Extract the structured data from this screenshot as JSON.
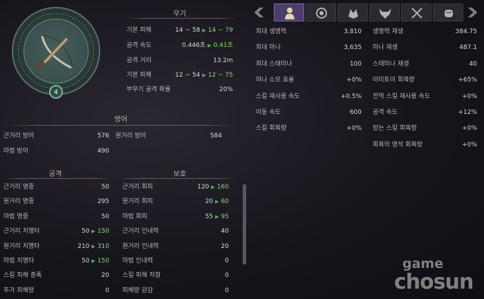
{
  "emblem": {
    "level": "4"
  },
  "weapon": {
    "title": "무기",
    "rows": [
      {
        "label": "기본 피해",
        "base": "14 ~ 58",
        "new": "14 ~ 79"
      },
      {
        "label": "공격 속도",
        "base": "0.446초",
        "new": "0.41초"
      },
      {
        "label": "공격 거리",
        "value": "13.2m"
      },
      {
        "label": "기본 피해",
        "base": "12 ~ 54",
        "new": "12 ~ 75"
      },
      {
        "label": "부무기 공격 확률",
        "value": "20%"
      }
    ]
  },
  "defense": {
    "title": "방어",
    "rows": [
      {
        "label": "근거리 방어",
        "value": "576"
      },
      {
        "label": "원거리 방어",
        "value": "584"
      },
      {
        "label": "마법 방어",
        "value": "490"
      }
    ]
  },
  "attack": {
    "title": "공격",
    "rows": [
      {
        "label": "근거리 명중",
        "value": "50"
      },
      {
        "label": "원거리 명중",
        "value": "295"
      },
      {
        "label": "마법 명중",
        "value": "50"
      },
      {
        "label": "근거리 치명타",
        "base": "50",
        "new": "150"
      },
      {
        "label": "원거리 치명타",
        "base": "210",
        "new": "310"
      },
      {
        "label": "마법 치명타",
        "base": "50",
        "new": "150"
      },
      {
        "label": "스킬 피해 증폭",
        "value": "20"
      },
      {
        "label": "추가 피해량",
        "value": "0"
      }
    ]
  },
  "protect": {
    "title": "보호",
    "rows": [
      {
        "label": "근거리 회피",
        "base": "120",
        "new": "160"
      },
      {
        "label": "원거리 회피",
        "base": "20",
        "new": "60"
      },
      {
        "label": "마법 회피",
        "base": "55",
        "new": "95"
      },
      {
        "label": "근거리 인내력",
        "value": "40"
      },
      {
        "label": "원거리 인내력",
        "value": "20"
      },
      {
        "label": "마법 인내력",
        "value": "0"
      },
      {
        "label": "스킬 피해 저항",
        "value": "0"
      },
      {
        "label": "피해량 감감",
        "value": "0"
      }
    ]
  },
  "tabs": [
    {
      "icon": "chevron-left-icon"
    },
    {
      "icon": "character-icon",
      "active": true
    },
    {
      "icon": "shield-icon"
    },
    {
      "icon": "wolf-icon"
    },
    {
      "icon": "demon-icon"
    },
    {
      "icon": "crossed-swords-icon"
    },
    {
      "icon": "fist-icon"
    },
    {
      "icon": "chevron-right-icon"
    }
  ],
  "stats_left": [
    {
      "label": "최대 생명력",
      "value": "3,810"
    },
    {
      "label": "최대 마나",
      "value": "3,635"
    },
    {
      "label": "최대 스태미나",
      "value": "100"
    },
    {
      "label": "마나 소모 효율",
      "value": "+0%"
    },
    {
      "label": "스킬 재사용 속도",
      "value": "+0.5%"
    },
    {
      "label": "이동 속도",
      "value": "600"
    },
    {
      "label": "스킬 회복량",
      "value": "+0%"
    }
  ],
  "stats_right": [
    {
      "label": "생명력 재생",
      "value": "384.75"
    },
    {
      "label": "마나 재생",
      "value": "487.1"
    },
    {
      "label": "스태미나 재생",
      "value": "40"
    },
    {
      "label": "아미토이 회복량",
      "value": "+65%"
    },
    {
      "label": "전역 스킬 재사용 속도",
      "value": "+0%"
    },
    {
      "label": "공격 속도",
      "value": "+12%"
    },
    {
      "label": "받는 스킬 회복량",
      "value": "+0%"
    },
    {
      "label": "회복의 영석 회복량",
      "value": "+0%"
    }
  ],
  "watermark": {
    "line1": "game",
    "line2": "chosun"
  }
}
